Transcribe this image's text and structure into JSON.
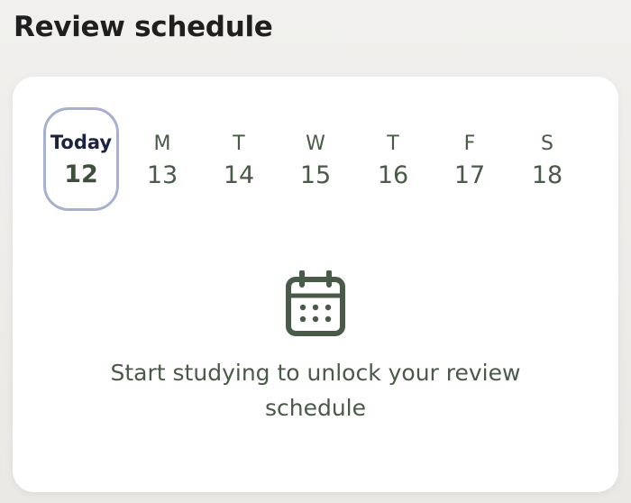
{
  "header": {
    "title": "Review schedule"
  },
  "week": {
    "days": [
      {
        "label": "Today",
        "number": "12"
      },
      {
        "label": "M",
        "number": "13"
      },
      {
        "label": "T",
        "number": "14"
      },
      {
        "label": "W",
        "number": "15"
      },
      {
        "label": "T",
        "number": "16"
      },
      {
        "label": "F",
        "number": "17"
      },
      {
        "label": "S",
        "number": "18"
      }
    ]
  },
  "empty_state": {
    "icon": "calendar-icon",
    "message": "Start studying to unlock your review schedule"
  },
  "colors": {
    "accent_text": "#4a5a48",
    "today_ring": "#a6b0cf",
    "today_label": "#1b2340"
  }
}
